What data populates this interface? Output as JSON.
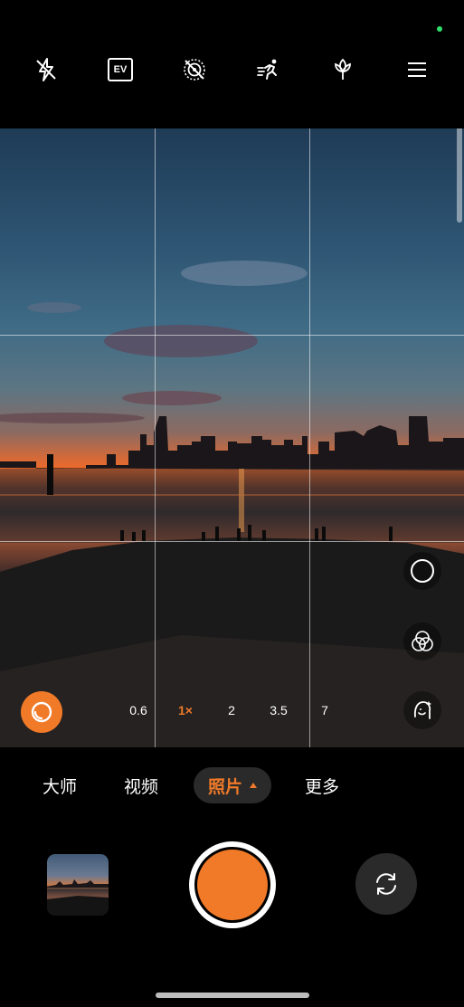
{
  "top_bar": {
    "icons": [
      "flash-off-icon",
      "ev-icon",
      "live-photo-off-icon",
      "motion-capture-icon",
      "macro-icon",
      "menu-icon"
    ],
    "ev_label": "EV"
  },
  "zoom": {
    "levels": [
      "0.6",
      "1×",
      "2",
      "3.5",
      "7"
    ],
    "active": "1×"
  },
  "modes": {
    "items": [
      "大师",
      "视频",
      "照片",
      "更多"
    ],
    "active": "照片"
  },
  "side_controls": [
    "focus-circle-icon",
    "filter-icon",
    "portrait-enhance-icon"
  ],
  "colors": {
    "accent": "#f07a28",
    "status_dot": "#2ee06a"
  }
}
